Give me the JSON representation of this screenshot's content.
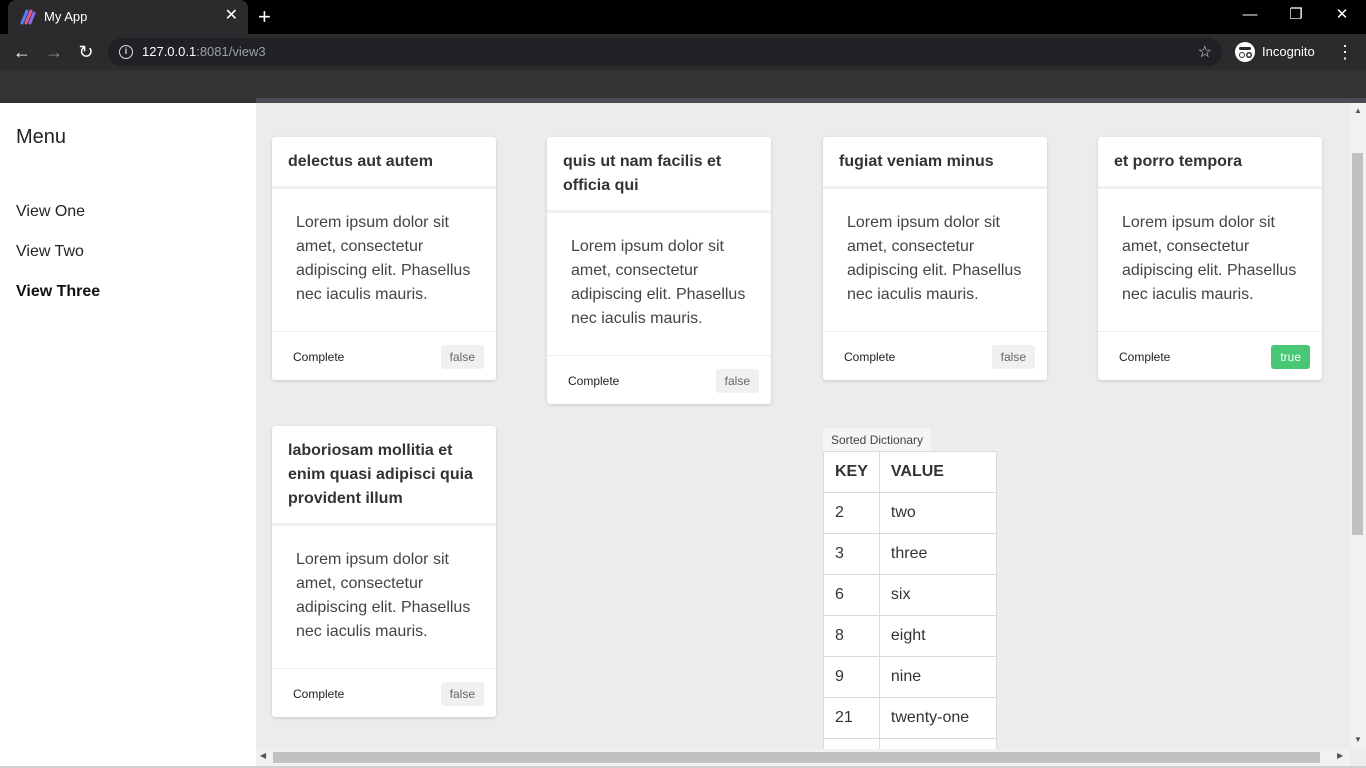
{
  "browser": {
    "tab_title": "My App",
    "tab_close": "✕",
    "new_tab": "+",
    "url_host": "127.0.0.1",
    "url_rest": ":8081/view3",
    "incognito_label": "Incognito",
    "minimize": "—",
    "restore": "❐",
    "close": "✕"
  },
  "sidebar": {
    "title": "Menu",
    "items": [
      {
        "label": "View One",
        "active": false
      },
      {
        "label": "View Two",
        "active": false
      },
      {
        "label": "View Three",
        "active": true
      }
    ]
  },
  "cards": [
    {
      "title": "delectus aut autem",
      "body": "Lorem ipsum dolor sit amet, consectetur adipiscing elit. Phasellus nec iaculis mauris.",
      "complete_label": "Complete",
      "complete_value": "false"
    },
    {
      "title": "quis ut nam facilis et officia qui",
      "body": "Lorem ipsum dolor sit amet, consectetur adipiscing elit. Phasellus nec iaculis mauris.",
      "complete_label": "Complete",
      "complete_value": "false"
    },
    {
      "title": "fugiat veniam minus",
      "body": "Lorem ipsum dolor sit amet, consectetur adipiscing elit. Phasellus nec iaculis mauris.",
      "complete_label": "Complete",
      "complete_value": "false"
    },
    {
      "title": "et porro tempora",
      "body": "Lorem ipsum dolor sit amet, consectetur adipiscing elit. Phasellus nec iaculis mauris.",
      "complete_label": "Complete",
      "complete_value": "true"
    },
    {
      "title": "laboriosam mollitia et enim quasi adipisci quia provident illum",
      "body": "Lorem ipsum dolor sit amet, consectetur adipiscing elit. Phasellus nec iaculis mauris.",
      "complete_label": "Complete",
      "complete_value": "false"
    }
  ],
  "dictionary": {
    "tag": "Sorted Dictionary",
    "headers": [
      "KEY",
      "VALUE"
    ],
    "rows": [
      [
        "2",
        "two"
      ],
      [
        "3",
        "three"
      ],
      [
        "6",
        "six"
      ],
      [
        "8",
        "eight"
      ],
      [
        "9",
        "nine"
      ],
      [
        "21",
        "twenty-one"
      ],
      [
        "",
        ""
      ]
    ]
  },
  "colors": {
    "accent_true": "#48c774",
    "header_bg": "#333333",
    "main_bg": "#ececec"
  }
}
